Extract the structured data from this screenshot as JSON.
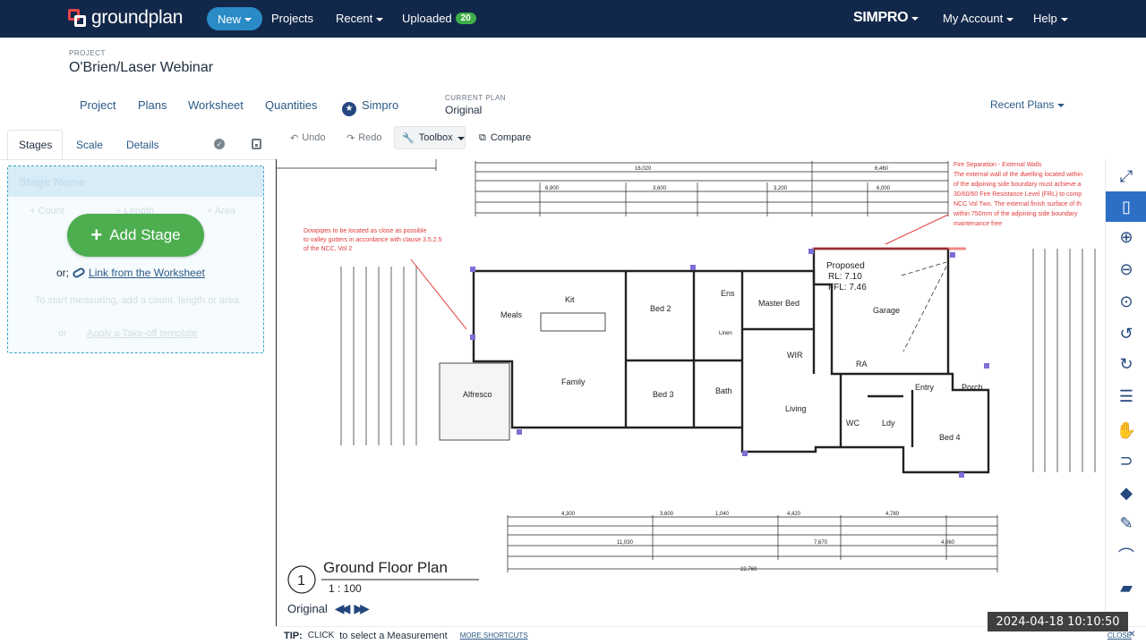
{
  "nav": {
    "logo_text": "groundplan",
    "new_label": "New",
    "projects_label": "Projects",
    "recent_label": "Recent",
    "uploaded_label": "Uploaded",
    "uploaded_count": "20",
    "simpro_label": "SIMPRO",
    "account_label": "My Account",
    "help_label": "Help"
  },
  "project": {
    "label": "PROJECT",
    "title": "O'Brien/Laser Webinar",
    "tabs": [
      "Project",
      "Plans",
      "Worksheet",
      "Quantities",
      "Simpro"
    ],
    "current_plan_label": "CURRENT PLAN",
    "current_plan_value": "Original",
    "recent_plans_label": "Recent Plans"
  },
  "left_panel": {
    "tabs": [
      "Stages",
      "Scale",
      "Details"
    ],
    "stage_name_placeholder": "Stage Name",
    "faded_count": "+ Count",
    "faded_length": "+ Length",
    "faded_area": "+ Area",
    "faded_hint": "To start measuring, add a count, length or area",
    "faded_template_prefix": "or",
    "faded_template": "Apply a Take-off template",
    "add_stage_label": "Add Stage",
    "or_label": "or;",
    "worksheet_link": "Link from the Worksheet"
  },
  "toolbar": {
    "undo_label": "Undo",
    "redo_label": "Redo",
    "toolbox_label": "Toolbox",
    "compare_label": "Compare"
  },
  "plan": {
    "title": "Ground Floor Plan",
    "scale": "1 : 100",
    "number": "1",
    "note_left": [
      "Dowpipes to be located as close as possible",
      "to valley gutters in accordance with clause 3.5.2.5",
      "of the NCC, Vol 2"
    ],
    "note_right": [
      "Fire Separation - External Walls",
      "The external wall of the dwelling located within",
      "of the adjoining side boundary must achieve a",
      "30/60/60 Fire Resistance Level (FRL) to comp",
      "NCC Vol Two. The external finish surface of th",
      "within 750mm of the adjoining side boundary",
      "maintenance free"
    ],
    "rooms": [
      "Meals",
      "Kit",
      "Family",
      "Bed 2",
      "Bed 3",
      "Ens",
      "Master Bed",
      "WIR",
      "Bath",
      "Garage",
      "Living",
      "Entry",
      "Porch",
      "WC",
      "Ldy",
      "Bed 4",
      "Alfresco",
      "RA",
      "Linen"
    ],
    "proposed": [
      "Proposed",
      "RL: 7.10",
      "FFL: 7.46"
    ],
    "dims_top": [
      "16,020",
      "6,460",
      "6,900",
      "6,000",
      "3,600",
      "3,200",
      "6,000"
    ],
    "dims_bottom": [
      "4,300",
      "3,600",
      "1,040",
      "4,420",
      "4,780",
      "11,030",
      "7,670",
      "4,060",
      "22,760"
    ]
  },
  "bottom": {
    "plan_chip": "Original",
    "tip_label": "TIP:",
    "tip_key": "CLICK",
    "tip_text": "to select a Measurement",
    "shortcuts": "MORE SHORTCUTS",
    "close": "CLOSE",
    "timestamp": "2024-04-18  10:10:50"
  },
  "right_tools": [
    "expand-icon",
    "panel-icon",
    "zoom-in-icon",
    "zoom-out-icon",
    "zoom-fit-icon",
    "rotate-left-icon",
    "rotate-right-icon",
    "list-icon",
    "hand-icon",
    "magnet-icon",
    "eraser-icon",
    "pen-icon",
    "arc-icon",
    "ruler-icon"
  ],
  "colors": {
    "nav_bg": "#12284a",
    "accent_blue": "#2a8bc7",
    "add_green": "#4cae4f",
    "badge_green": "#3fae49",
    "link_blue": "#2c5a86",
    "active_tool": "#2d6fc4",
    "plan_red": "#e23b3b"
  }
}
